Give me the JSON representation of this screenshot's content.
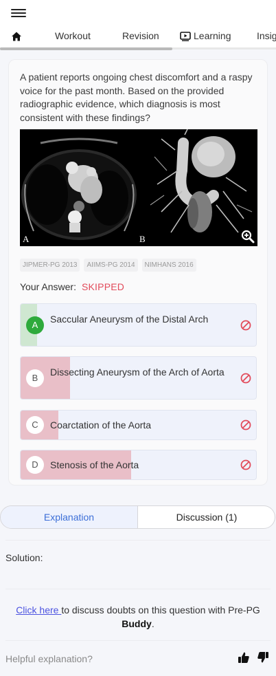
{
  "header": {
    "menu_icon": "hamburger-icon",
    "tabs": [
      {
        "icon": "home-icon",
        "label": ""
      },
      {
        "label": "Workout"
      },
      {
        "label": "Revision"
      },
      {
        "icon": "play-box-icon",
        "label": "Learning"
      },
      {
        "label": "Insig"
      }
    ]
  },
  "question": {
    "text": "A patient reports ongoing chest discomfort and a raspy voice for the past month. Based on the provided radiographic evidence, which diagnosis is most consistent with these findings?",
    "image_panels": [
      "A",
      "B"
    ],
    "zoom_icon": "zoom-in-icon",
    "tags": [
      "JIPMER-PG 2013",
      "AIIMS-PG 2014",
      "NIMHANS 2016"
    ],
    "your_answer_label": "Your Answer:",
    "your_answer_status": "SKIPPED",
    "options": [
      {
        "letter": "A",
        "text": "Saccular Aneurysm of the Distal Arch",
        "correct": true,
        "response_share": 0.07
      },
      {
        "letter": "B",
        "text": "Dissecting Aneurysm of the Arch of Aorta",
        "correct": false,
        "response_share": 0.21
      },
      {
        "letter": "C",
        "text": "Coarctation of the Aorta",
        "correct": false,
        "response_share": 0.16
      },
      {
        "letter": "D",
        "text": "Stenosis of the Aorta",
        "correct": false,
        "response_share": 0.47
      }
    ]
  },
  "colors": {
    "accent": "#3c6fd8",
    "skipped": "#e24b5b",
    "correct": "#2eaa3c",
    "wrong_fill": "#e9bfc8",
    "correct_fill": "#cfe7d1"
  },
  "explanation": {
    "tab_explanation": "Explanation",
    "tab_discussion": "Discussion (1)",
    "solution_label": "Solution:",
    "doubt_link": "Click here ",
    "doubt_text": "to discuss doubts on this question with Pre-PG ",
    "doubt_bold": "Buddy",
    "doubt_end": ".",
    "helpful_label": "Helpful explanation?"
  }
}
